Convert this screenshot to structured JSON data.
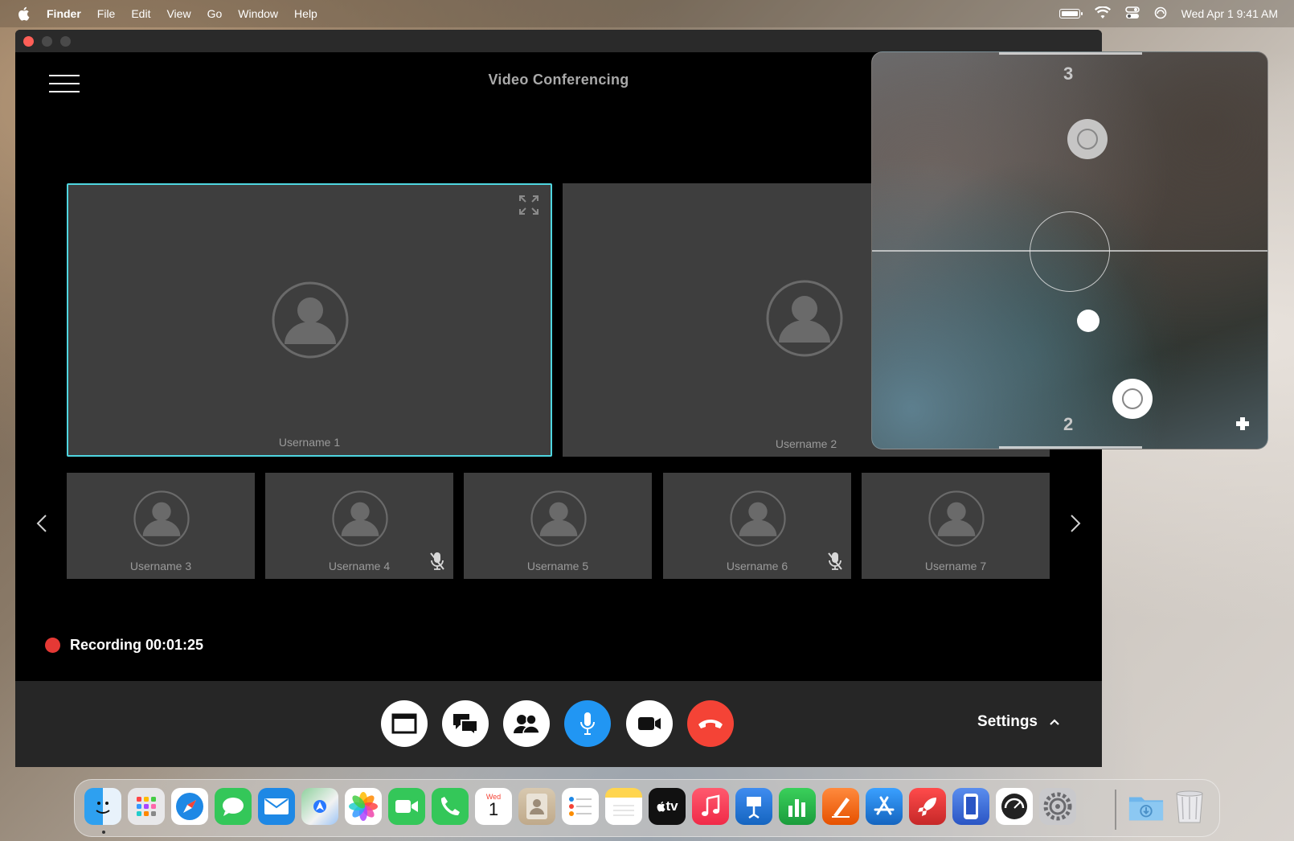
{
  "menubar": {
    "app_name": "Finder",
    "menus": [
      "File",
      "Edit",
      "View",
      "Go",
      "Window",
      "Help"
    ],
    "datetime": "Wed Apr 1  9:41 AM"
  },
  "app": {
    "title": "Video Conferencing",
    "main_participants": [
      {
        "username": "Username 1",
        "active": true
      },
      {
        "username": "Username 2",
        "active": false
      }
    ],
    "thumb_participants": [
      {
        "username": "Username 3",
        "muted": false
      },
      {
        "username": "Username 4",
        "muted": true
      },
      {
        "username": "Username 5",
        "muted": false
      },
      {
        "username": "Username 6",
        "muted": true
      },
      {
        "username": "Username 7",
        "muted": false
      }
    ],
    "recording_label": "Recording 00:01:25",
    "settings_label": "Settings",
    "controls": [
      "share-screen",
      "chat",
      "participants",
      "microphone",
      "camera",
      "end-call"
    ],
    "accent_color": "#4fd6e0",
    "mic_color": "#2196f3",
    "end_call_color": "#f44336"
  },
  "overlay": {
    "top_number": "3",
    "bottom_number": "2"
  },
  "dock": {
    "calendar_day": "Wed",
    "calendar_date": "1",
    "tv_label": "tv"
  }
}
